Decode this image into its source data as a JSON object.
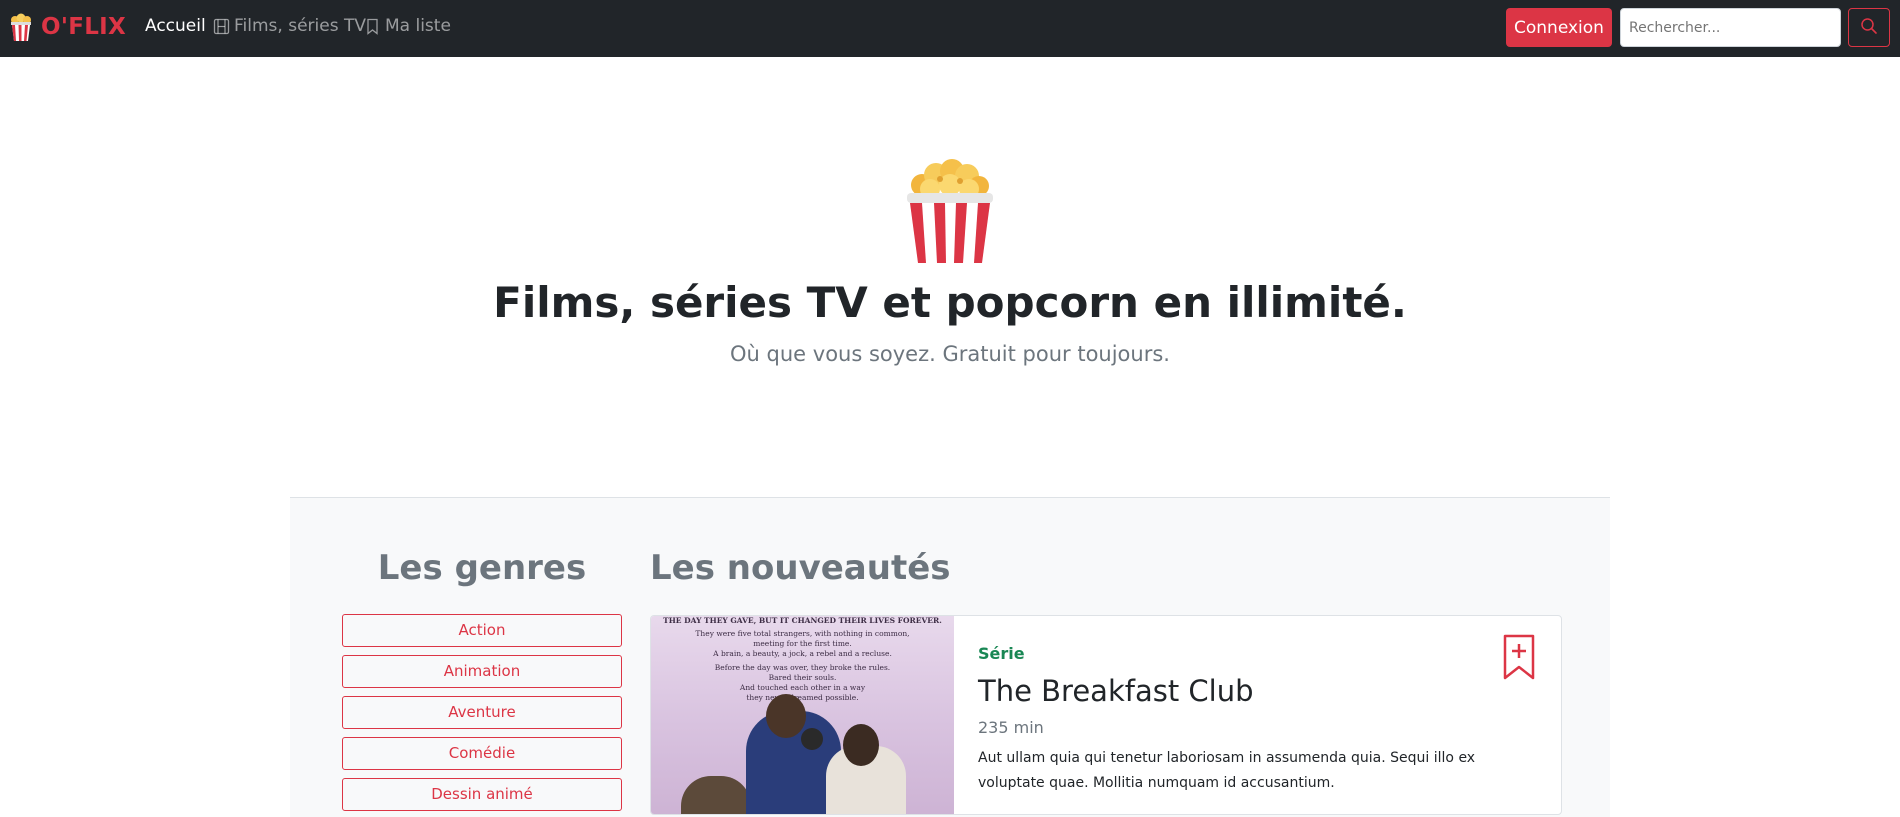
{
  "navbar": {
    "brand": "O'FLIX",
    "links": [
      {
        "label": "Accueil",
        "icon": "",
        "active": true
      },
      {
        "label": "Films, séries TV",
        "icon": "film-icon",
        "active": false
      },
      {
        "label": "Ma liste",
        "icon": "bookmark-icon",
        "active": false
      }
    ],
    "login_label": "Connexion",
    "search_placeholder": "Rechercher..."
  },
  "hero": {
    "icon": "popcorn-icon",
    "title": "Films, séries TV et popcorn en illimité.",
    "subtitle": "Où que vous soyez. Gratuit pour toujours."
  },
  "genres": {
    "heading": "Les genres",
    "items": [
      "Action",
      "Animation",
      "Aventure",
      "Comédie",
      "Dessin animé"
    ]
  },
  "news": {
    "heading": "Les nouveautés",
    "card": {
      "type": "Série",
      "title": "The Breakfast Club",
      "duration": "235 min",
      "description": "Aut ullam quia qui tenetur laboriosam in assumenda quia. Sequi illo ex voluptate quae. Mollitia numquam id accusantium.",
      "poster_text": [
        "THE DAY THEY GAVE, BUT IT CHANGED THEIR LIVES FOREVER.",
        "They were five total strangers, with nothing in common,",
        "meeting for the first time.",
        "A brain, a beauty, a jock, a rebel and a recluse.",
        "Before the day was over, they broke the rules.",
        "Bared their souls.",
        "And touched each other in a way",
        "they never dreamed possible."
      ]
    }
  },
  "colors": {
    "brand": "#dc3545",
    "navbar_bg": "#212529",
    "success": "#198754",
    "muted": "#6c757d"
  }
}
